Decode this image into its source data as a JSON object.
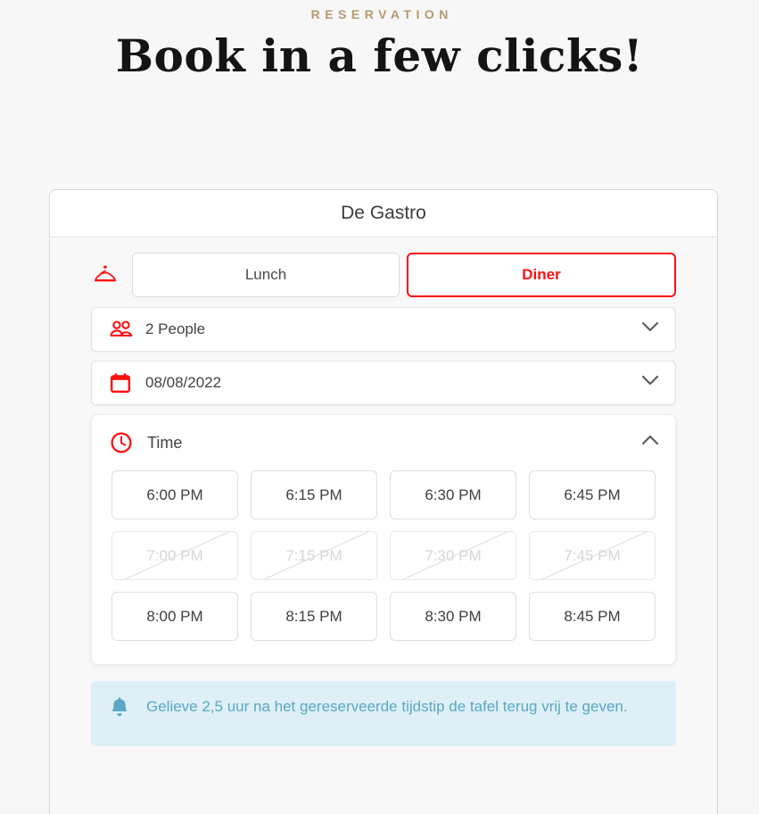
{
  "header": {
    "eyebrow": "RESERVATION",
    "headline": "Book in a few clicks!",
    "eyebrow_color": "#b69a71"
  },
  "card": {
    "restaurant_name": "De Gastro",
    "accent_color": "#fc1111"
  },
  "service": {
    "icon": "cloche-icon",
    "options": [
      {
        "label": "Lunch",
        "selected": false
      },
      {
        "label": "Diner",
        "selected": true
      }
    ]
  },
  "party_size": {
    "icon": "people-icon",
    "value": "2 People",
    "chevron": "chevron-down-icon"
  },
  "date": {
    "icon": "calendar-icon",
    "value": "08/08/2022",
    "chevron": "chevron-down-icon"
  },
  "time_section": {
    "icon": "clock-icon",
    "label": "Time",
    "chevron": "chevron-up-icon",
    "expanded": true,
    "slots": [
      {
        "label": "6:00 PM",
        "disabled": false
      },
      {
        "label": "6:15 PM",
        "disabled": false
      },
      {
        "label": "6:30 PM",
        "disabled": false
      },
      {
        "label": "6:45 PM",
        "disabled": false
      },
      {
        "label": "7:00 PM",
        "disabled": true
      },
      {
        "label": "7:15 PM",
        "disabled": true
      },
      {
        "label": "7:30 PM",
        "disabled": true
      },
      {
        "label": "7:45 PM",
        "disabled": true
      },
      {
        "label": "8:00 PM",
        "disabled": false
      },
      {
        "label": "8:15 PM",
        "disabled": false
      },
      {
        "label": "8:30 PM",
        "disabled": false
      },
      {
        "label": "8:45 PM",
        "disabled": false
      }
    ]
  },
  "notice": {
    "icon": "bell-icon",
    "text": "Gelieve 2,5 uur na het gereserveerde tijdstip de tafel terug vrij te geven.",
    "text_color": "#5ba7c4",
    "background_color": "#def0f6"
  }
}
